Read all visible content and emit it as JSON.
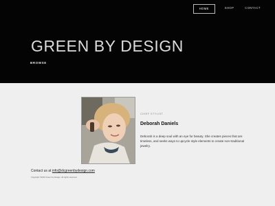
{
  "nav": {
    "items": [
      {
        "label": "HOME",
        "active": true
      },
      {
        "label": "SHOP",
        "active": false
      },
      {
        "label": "CONTACT",
        "active": false
      }
    ]
  },
  "hero": {
    "title": "GREEN BY DESIGN",
    "browse_label": "BROWSE"
  },
  "profile": {
    "role": "CHIEF STYLIST",
    "name": "Deborah Daniels",
    "bio": "Deborah is a deep soul with an eye for beauty.  She creates pieces that are timeless, and seeks ways to upcycle style elements to create non-traditional jewelry."
  },
  "footer": {
    "contact_prefix": "Contact us at ",
    "contact_email": "info@dcgreenbydesign.com",
    "copyright": "Copyright ©2016 Green by Design. All rights reserved."
  },
  "colors": {
    "hero_bg": "#040404",
    "content_bg": "#efefef",
    "title": "#dcdcdc"
  }
}
